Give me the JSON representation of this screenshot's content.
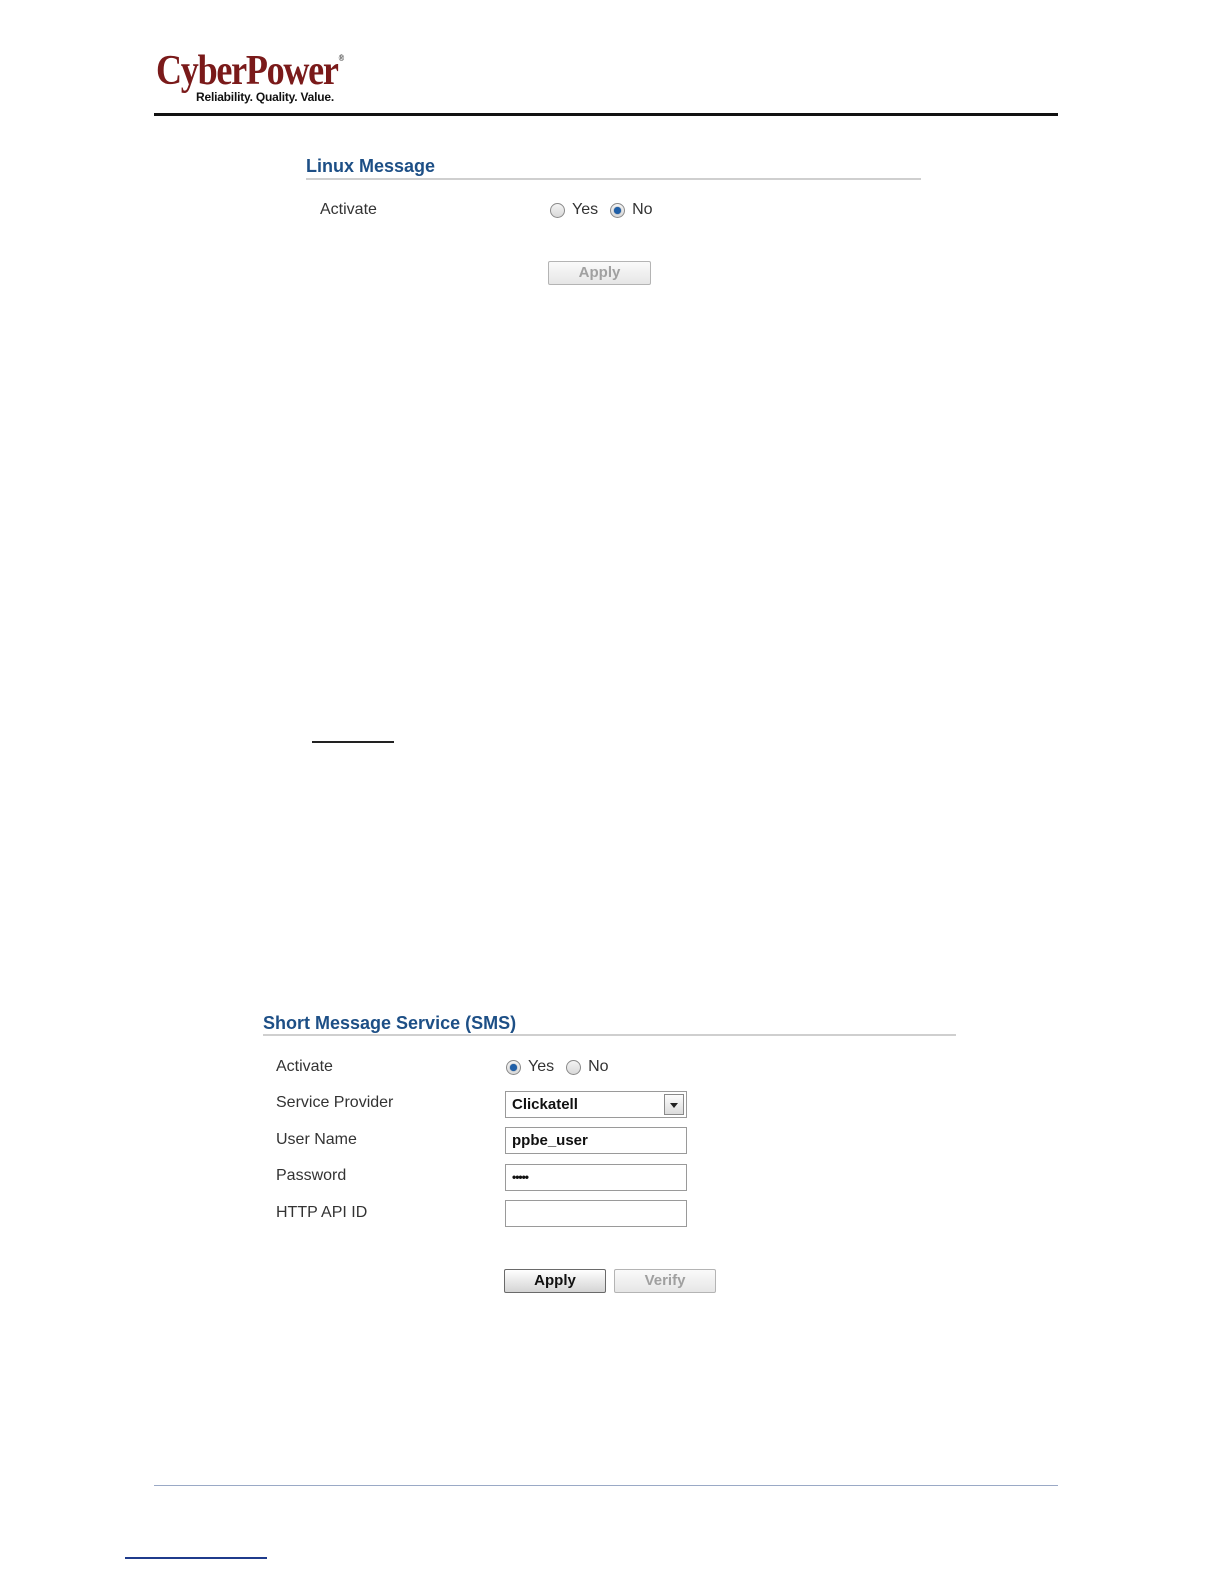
{
  "header": {
    "logo_text": "CyberPower",
    "logo_mark": "®",
    "tagline": "Reliability. Quality. Value."
  },
  "linux_panel": {
    "title": "Linux Message",
    "activate_label": "Activate",
    "yes_label": "Yes",
    "no_label": "No",
    "selected": "No",
    "apply_label": "Apply"
  },
  "sms_panel": {
    "title": "Short Message Service (SMS)",
    "activate_label": "Activate",
    "yes_label": "Yes",
    "no_label": "No",
    "selected": "Yes",
    "provider_label": "Service Provider",
    "provider_value": "Clickatell",
    "username_label": "User Name",
    "username_value": "ppbe_user",
    "password_label": "Password",
    "password_value": "•••••",
    "api_label": "HTTP API ID",
    "api_value": "",
    "apply_label": "Apply",
    "verify_label": "Verify"
  },
  "colors": {
    "title_blue": "#1d4f86",
    "logo_red": "#7a1a1a",
    "radio_selected": "#1f5fa8"
  }
}
